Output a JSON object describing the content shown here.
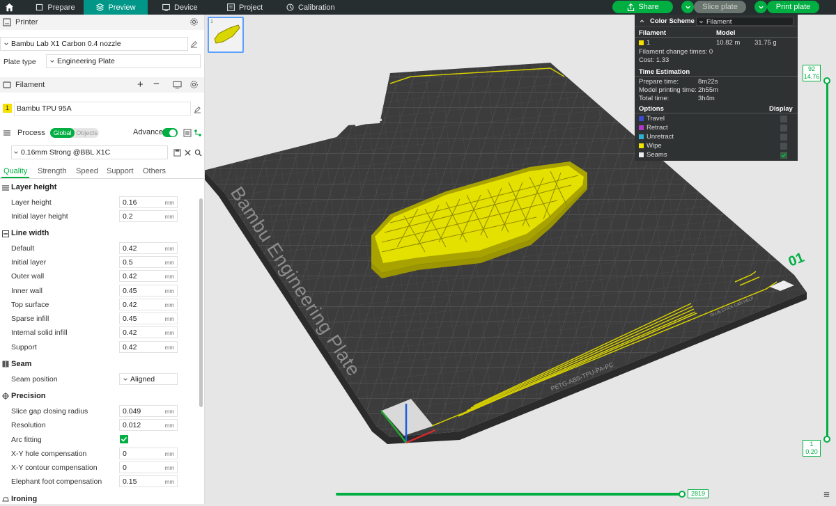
{
  "topbar": {
    "tabs": [
      {
        "label": "Prepare",
        "icon": "prepare-icon"
      },
      {
        "label": "Preview",
        "icon": "preview-icon"
      },
      {
        "label": "Device",
        "icon": "device-icon"
      },
      {
        "label": "Project",
        "icon": "project-icon"
      },
      {
        "label": "Calibration",
        "icon": "calibration-icon"
      }
    ],
    "share_label": "Share",
    "slice_label": "Slice plate",
    "print_label": "Print plate"
  },
  "printer": {
    "section_title": "Printer",
    "printer_name": "Bambu Lab X1 Carbon 0.4 nozzle",
    "plate_type_label": "Plate type",
    "plate_type_value": "Engineering Plate"
  },
  "filament": {
    "section_title": "Filament",
    "slot_number": "1",
    "name": "Bambu TPU 95A",
    "color": "#f5e100"
  },
  "process": {
    "section_title": "Process",
    "toggle_global": "Global",
    "toggle_objects": "Objects",
    "advance_label": "Advance",
    "preset": "0.16mm Strong @BBL X1C",
    "tabs": [
      "Quality",
      "Strength",
      "Speed",
      "Support",
      "Others"
    ]
  },
  "groups": {
    "layer_height": "Layer height",
    "line_width": "Line width",
    "seam": "Seam",
    "precision": "Precision",
    "ironing": "Ironing"
  },
  "settings": {
    "layer_height": {
      "label": "Layer height",
      "value": "0.16",
      "unit": "mm"
    },
    "initial_layer_height": {
      "label": "Initial layer height",
      "value": "0.2",
      "unit": "mm"
    },
    "default": {
      "label": "Default",
      "value": "0.42",
      "unit": "mm"
    },
    "initial_layer": {
      "label": "Initial layer",
      "value": "0.5",
      "unit": "mm"
    },
    "outer_wall": {
      "label": "Outer wall",
      "value": "0.42",
      "unit": "mm"
    },
    "inner_wall": {
      "label": "Inner wall",
      "value": "0.45",
      "unit": "mm"
    },
    "top_surface": {
      "label": "Top surface",
      "value": "0.42",
      "unit": "mm"
    },
    "sparse_infill": {
      "label": "Sparse infill",
      "value": "0.45",
      "unit": "mm"
    },
    "internal_solid_infill": {
      "label": "Internal solid infill",
      "value": "0.42",
      "unit": "mm"
    },
    "support": {
      "label": "Support",
      "value": "0.42",
      "unit": "mm"
    },
    "seam_position": {
      "label": "Seam position",
      "value": "Aligned"
    },
    "slice_gap": {
      "label": "Slice gap closing radius",
      "value": "0.049",
      "unit": "mm"
    },
    "resolution": {
      "label": "Resolution",
      "value": "0.012",
      "unit": "mm"
    },
    "arc_fitting": {
      "label": "Arc fitting",
      "checked": true
    },
    "xy_hole": {
      "label": "X-Y hole compensation",
      "value": "0",
      "unit": "mm"
    },
    "xy_contour": {
      "label": "X-Y contour compensation",
      "value": "0",
      "unit": "mm"
    },
    "elephant_foot": {
      "label": "Elephant foot compensation",
      "value": "0.15",
      "unit": "mm"
    }
  },
  "plate": {
    "text": "Bambu Engineering Plate",
    "number": "01",
    "small_label": "PETG-ABS-TPU-PA-PC",
    "glue_text": "GLUE STICK CAN HELP"
  },
  "info_panel": {
    "color_scheme_label": "Color Scheme",
    "color_scheme_value": "Filament",
    "filament_header": "Filament",
    "model_header": "Model",
    "filament_id": "1",
    "length": "10.82 m",
    "weight": "31.75 g",
    "change_times": "Filament change times: 0",
    "cost": "Cost:  1.33",
    "time_header": "Time Estimation",
    "prepare_label": "Prepare time:",
    "prepare_value": "8m22s",
    "model_time_label": "Model printing time:",
    "model_time_value": "2h55m",
    "total_label": "Total time:",
    "total_value": "3h4m",
    "options_header": "Options",
    "display_header": "Display",
    "options": [
      {
        "label": "Travel",
        "color": "#3b4bd6"
      },
      {
        "label": "Retract",
        "color": "#b03ac8"
      },
      {
        "label": "Unretract",
        "color": "#2fb2d1"
      },
      {
        "label": "Wipe",
        "color": "#f2e600"
      },
      {
        "label": "Seams",
        "color": "#eeeeee"
      }
    ]
  },
  "layer_slider": {
    "top_layer": "92",
    "top_height": "14.76",
    "bottom_layer": "1",
    "bottom_height": "0.20"
  },
  "move_slider": {
    "value": "2819"
  }
}
